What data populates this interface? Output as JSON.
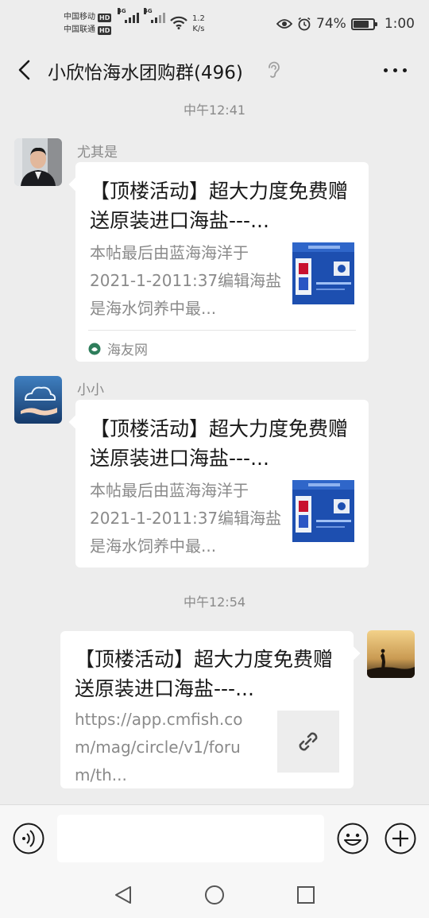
{
  "status_bar": {
    "carrier1": "中国移动",
    "carrier2": "中国联通",
    "hd_label": "HD",
    "network1": "4G",
    "network2": "4G",
    "speed_value": "1.2",
    "speed_unit": "K/s",
    "battery_percent": "74%",
    "battery_level": 0.74,
    "time": "1:00"
  },
  "header": {
    "title": "小欣怡海水团购群(496)"
  },
  "messages": [
    {
      "timestamp": "中午12:41",
      "sender": "尤其是",
      "title": "【顶楼活动】超大力度免费赠送原装进口海盐---...",
      "desc": "本帖最后由蓝海海洋于2021-1-2011:37编辑海盐是海水饲养中最...",
      "source": "海友网"
    },
    {
      "sender": "小小",
      "title": "【顶楼活动】超大力度免费赠送原装进口海盐---...",
      "desc": "本帖最后由蓝海海洋于2021-1-2011:37编辑海盐是海水饲养中最..."
    },
    {
      "timestamp": "中午12:54",
      "title": "【顶楼活动】超大力度免费赠送原装进口海盐---...",
      "desc": "https://app.cmfish.com/mag/circle/v1/forum/th..."
    }
  ],
  "icons": {
    "back": "back-arrow-icon",
    "mute": "mute-ear-icon",
    "more": "more-dots-icon",
    "voice": "voice-icon",
    "emoji": "emoji-icon",
    "add": "plus-icon",
    "link": "link-icon"
  },
  "colors": {
    "background": "#ededed",
    "bubble": "#ffffff",
    "secondary_text": "#8a8a8a",
    "source_logo": "#2e7d5b"
  }
}
